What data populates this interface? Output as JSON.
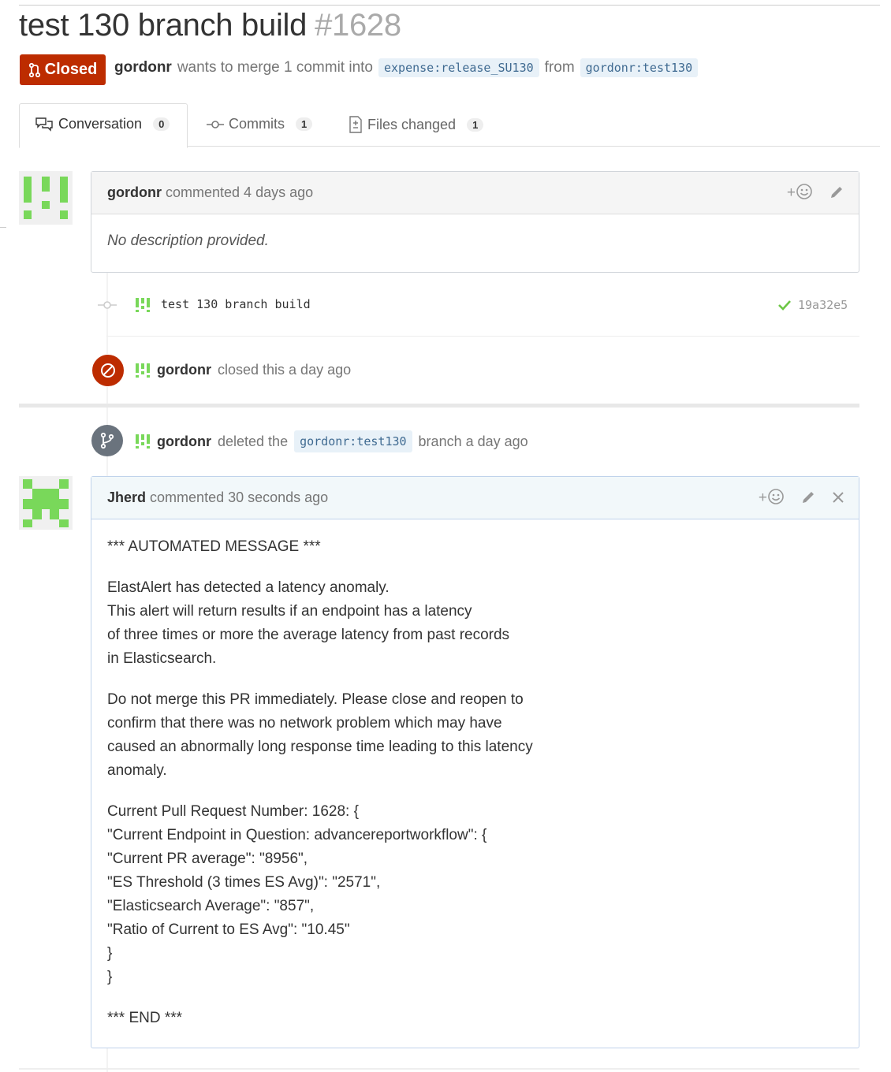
{
  "header": {
    "title": "test 130 branch build",
    "number": "#1628",
    "state_label": "Closed",
    "author": "gordonr",
    "merge_text": "wants to merge 1 commit into",
    "base_ref": "expense:release_SU130",
    "from_text": "from",
    "head_ref": "gordonr:test130"
  },
  "tabs": [
    {
      "label": "Conversation",
      "count": "0"
    },
    {
      "label": "Commits",
      "count": "1"
    },
    {
      "label": "Files changed",
      "count": "1"
    }
  ],
  "comment1": {
    "author": "gordonr",
    "meta": "commented 4 days ago",
    "body": "No description provided."
  },
  "commit": {
    "message": "test 130 branch build",
    "sha": "19a32e5"
  },
  "event_closed": {
    "author": "gordonr",
    "text": "closed this a day ago"
  },
  "event_deleted": {
    "author": "gordonr",
    "text_before": "deleted the",
    "ref": "gordonr:test130",
    "text_after": "branch a day ago"
  },
  "comment2": {
    "author": "Jherd",
    "meta": "commented 30 seconds ago",
    "lines": {
      "header": "*** AUTOMATED MESSAGE ***",
      "p1_l1": "ElastAlert has detected a latency anomaly.",
      "p1_l2": "This alert will return results if an endpoint has a latency",
      "p1_l3": "of three times or more the average latency from past records",
      "p1_l4": "in Elasticsearch.",
      "p2_l1": "Do not merge this PR immediately. Please close and reopen to",
      "p2_l2": "confirm that there was no network problem which may have",
      "p2_l3": "caused an abnormally long response time leading to this latency",
      "p2_l4": "anomaly.",
      "p3_l1": "Current Pull Request Number: 1628: {",
      "p3_l2": "\"Current Endpoint in Question: advancereportworkflow\": {",
      "p3_l3": "\"Current PR average\": \"8956\",",
      "p3_l4": "\"ES Threshold (3 times ES Avg)\": \"2571\",",
      "p3_l5": "\"Elasticsearch Average\": \"857\",",
      "p3_l6": "\"Ratio of Current to ES Avg\": \"10.45\"",
      "p3_l7": "}",
      "p3_l8": "}",
      "footer": "*** END ***"
    }
  },
  "colors": {
    "closed_red": "#bd2c00",
    "ref_bg": "#e8f1f8",
    "ref_text": "#3f6a91",
    "check_green": "#6cc644",
    "identicon_green": "#79d85a"
  }
}
